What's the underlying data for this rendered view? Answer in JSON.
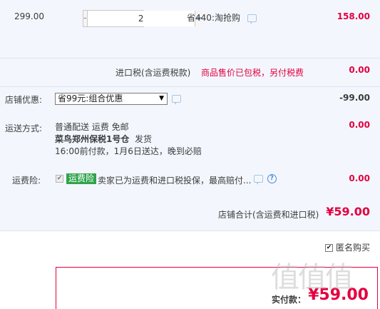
{
  "item": {
    "unit_price": "299.00",
    "quantity": "2",
    "minus": "-",
    "plus": "+",
    "promotion": "省440:淘抢购",
    "total": "158.00"
  },
  "tax": {
    "label": "进口税(含运费税款)",
    "note": "商品售价已包税，另付税费",
    "value": "0.00"
  },
  "shop_discount": {
    "label": "店铺优惠:",
    "selected": "省99元:组合优惠",
    "value": "-99.00"
  },
  "shipping": {
    "label": "运送方式:",
    "method": "普通配送 运费 免邮",
    "warehouse": "菜鸟郑州保税1号仓",
    "dispatch": "发货",
    "eta": "16:00前付款，1月6日送达，晚到必赔",
    "value": "0.00"
  },
  "insurance": {
    "label": "运费险:",
    "badge": "运费险",
    "description": "卖家已为运费和进口税投保，最高赔付...",
    "help": "?",
    "value": "0.00"
  },
  "subtotal": {
    "label": "店铺合计(含运费和进口税)",
    "value": "¥59.00"
  },
  "anonymous": {
    "label": "匿名购买"
  },
  "payment": {
    "label": "实付款：",
    "value": "¥59.00"
  },
  "watermark": "值值值",
  "colors": {
    "price_red": "#e4003f",
    "panel_bg": "#f3f7fd",
    "badge_green": "#2ea34b"
  }
}
